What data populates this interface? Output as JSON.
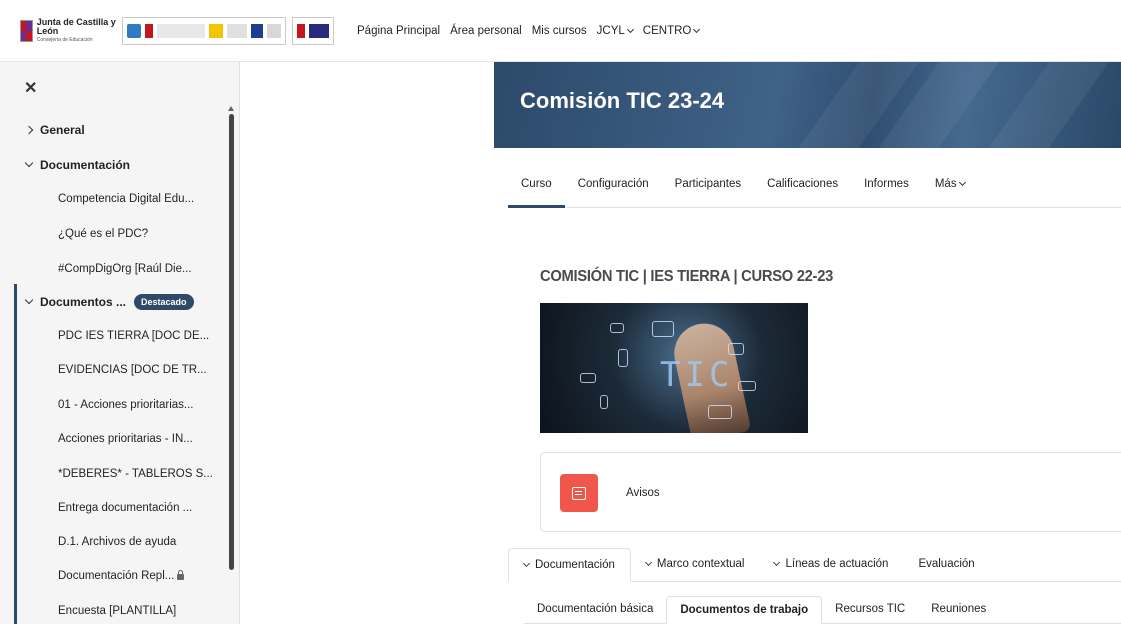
{
  "navbar": {
    "logo_title": "Junta de Castilla y León",
    "logo_subtitle": "Consejería de Educación",
    "links": [
      {
        "label": "Página Principal",
        "dropdown": false
      },
      {
        "label": "Área personal",
        "dropdown": false
      },
      {
        "label": "Mis cursos",
        "dropdown": false
      },
      {
        "label": "JCYL",
        "dropdown": true
      },
      {
        "label": "CENTRO",
        "dropdown": true
      }
    ]
  },
  "sidebar": {
    "close_icon": "close-icon",
    "sections": [
      {
        "label": "General",
        "expanded": false
      },
      {
        "label": "Documentación",
        "expanded": true
      },
      {
        "label": "Documentos ...",
        "expanded": true,
        "badge": "Destacado"
      }
    ],
    "documentacion_items": [
      "Competencia Digital Edu...",
      "¿Qué es el PDC?",
      "#CompDigOrg [Raúl Die..."
    ],
    "documentos_items": [
      "PDC IES TIERRA [DOC DE...",
      "EVIDENCIAS [DOC DE TR...",
      "01 - Acciones prioritarias...",
      "Acciones prioritarias - IN...",
      "*DEBERES* - TABLEROS S...",
      "Entrega documentación ...",
      "D.1. Archivos de ayuda",
      "Documentación Repl...",
      "Encuesta [PLANTILLA]"
    ]
  },
  "course": {
    "title": "Comisión TIC 23-24",
    "secondary_nav": [
      {
        "label": "Curso",
        "active": true
      },
      {
        "label": "Configuración",
        "active": false
      },
      {
        "label": "Participantes",
        "active": false
      },
      {
        "label": "Calificaciones",
        "active": false
      },
      {
        "label": "Informes",
        "active": false
      },
      {
        "label": "Más",
        "active": false,
        "dropdown": true
      }
    ],
    "heading": "COMISIÓN TIC | IES TIERRA | CURSO 22-23",
    "image_text": "TIC",
    "avisos_label": "Avisos",
    "tabs_level1": [
      {
        "label": "Documentación",
        "active": true,
        "chevron": true
      },
      {
        "label": "Marco contextual",
        "active": false,
        "chevron": true
      },
      {
        "label": "Líneas de actuación",
        "active": false,
        "chevron": true
      },
      {
        "label": "Evaluación",
        "active": false,
        "chevron": false
      }
    ],
    "tabs_level2": [
      {
        "label": "Documentación básica",
        "active": false
      },
      {
        "label": "Documentos de trabajo",
        "active": true
      },
      {
        "label": "Recursos TIC",
        "active": false
      },
      {
        "label": "Reuniones",
        "active": false
      }
    ]
  },
  "colors": {
    "brand": "#2f4a69",
    "avisos": "#f0574a"
  }
}
